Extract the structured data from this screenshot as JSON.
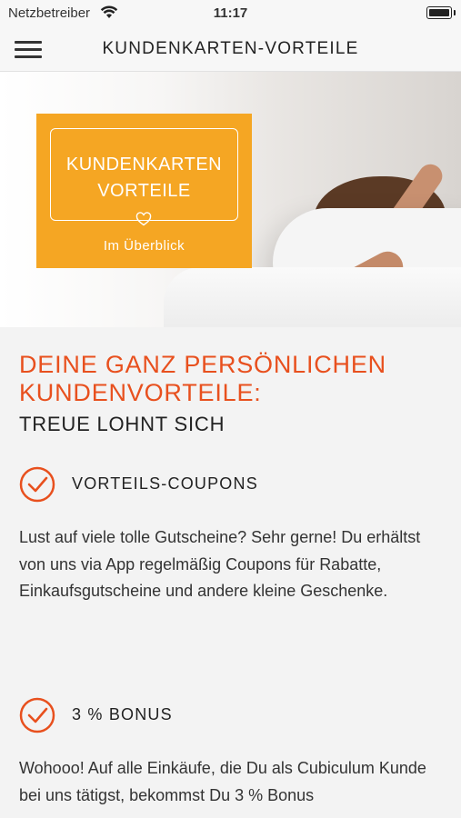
{
  "status_bar": {
    "carrier": "Netzbetreiber",
    "time": "11:17"
  },
  "nav": {
    "title": "KUNDENKARTEN-VORTEILE",
    "menu_icon": "hamburger-icon"
  },
  "hero": {
    "promo_line1": "KUNDENKARTEN",
    "promo_line2": "VORTEILE",
    "promo_sub": "Im Überblick",
    "promo_icon": "heart-icon",
    "promo_color": "#f5a623"
  },
  "content": {
    "heading_line1": "DEINE GANZ PERSÖNLICHEN",
    "heading_line2": "KUNDENVORTEILE:",
    "subheading": "TREUE LOHNT SICH",
    "accent_color": "#e8501e",
    "features": [
      {
        "icon": "check-circle-icon",
        "title": "VORTEILS-COUPONS",
        "text": "Lust auf viele tolle Gutscheine? Sehr gerne! Du erhältst von uns via App regelmäßig Coupons für Rabatte, Einkaufsgutscheine und andere kleine Geschenke."
      },
      {
        "icon": "check-circle-icon",
        "title": "3 % BONUS",
        "text": "Wohooo! Auf alle Einkäufe, die Du als Cubiculum Kunde bei uns tätigst, bekommst Du 3 % Bonus"
      }
    ]
  }
}
